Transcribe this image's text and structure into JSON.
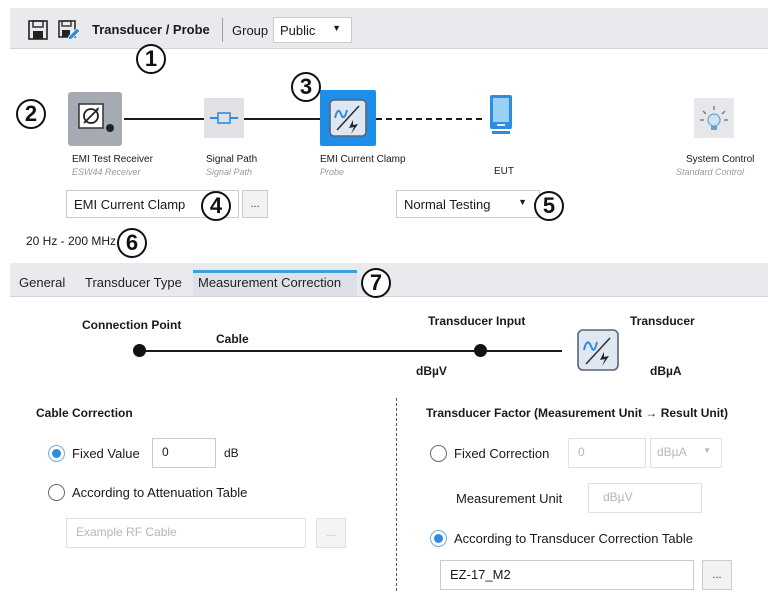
{
  "toolbar": {
    "title": "Transducer / Probe",
    "group_label": "Group",
    "group_value": "Public",
    "save_icon": "save-icon",
    "save_as_icon": "save-as-edit-icon"
  },
  "chain": {
    "devices": [
      {
        "label": "EMI Test Receiver",
        "sub": "ESW44 Receiver",
        "icon": "receiver-icon"
      },
      {
        "label": "Signal Path",
        "sub": "Signal Path",
        "icon": "signal-path-icon"
      },
      {
        "label": "EMI Current Clamp",
        "sub": "Probe",
        "icon": "current-clamp-icon"
      },
      {
        "label": "EUT",
        "sub": "",
        "icon": "eut-device-icon"
      },
      {
        "label": "System Control",
        "sub": "Standard Control",
        "icon": "light-bulb-icon"
      }
    ],
    "selected_device_field": "EMI Current Clamp",
    "browse_label": "...",
    "mode_value": "Normal Testing",
    "frequency_range": "20 Hz - 200 MHz"
  },
  "callouts": [
    "1",
    "2",
    "3",
    "4",
    "5",
    "6",
    "7"
  ],
  "tabs": [
    {
      "label": "General",
      "active": false
    },
    {
      "label": "Transducer Type",
      "active": false
    },
    {
      "label": "Measurement Correction",
      "active": true
    }
  ],
  "diagram": {
    "connection_point": "Connection Point",
    "cable": "Cable",
    "transducer_input": "Transducer Input",
    "transducer": "Transducer",
    "input_unit": "dBµV",
    "output_unit": "dBµA"
  },
  "cable_correction": {
    "heading": "Cable Correction",
    "fixed_value_label": "Fixed Value",
    "fixed_value": "0",
    "fixed_unit": "dB",
    "attenuation_label": "According to Attenuation Table",
    "attenuation_placeholder": "Example RF Cable",
    "browse_label": "..."
  },
  "transducer_factor": {
    "heading": "Transducer Factor (Measurement Unit → Result Unit)",
    "fixed_correction_label": "Fixed Correction",
    "fixed_correction_value": "0",
    "fixed_correction_unit": "dBµA",
    "measurement_unit_label": "Measurement Unit",
    "measurement_unit_value": "dBµV",
    "table_label": "According to Transducer Correction Table",
    "table_value": "EZ-17_M2",
    "browse_label": "..."
  },
  "colors": {
    "toolbar_bg": "#e9eaee",
    "accent": "#2f8de0",
    "active_tab_border": "#3aa0e0",
    "clamp_highlight": "#1e8fe8"
  }
}
